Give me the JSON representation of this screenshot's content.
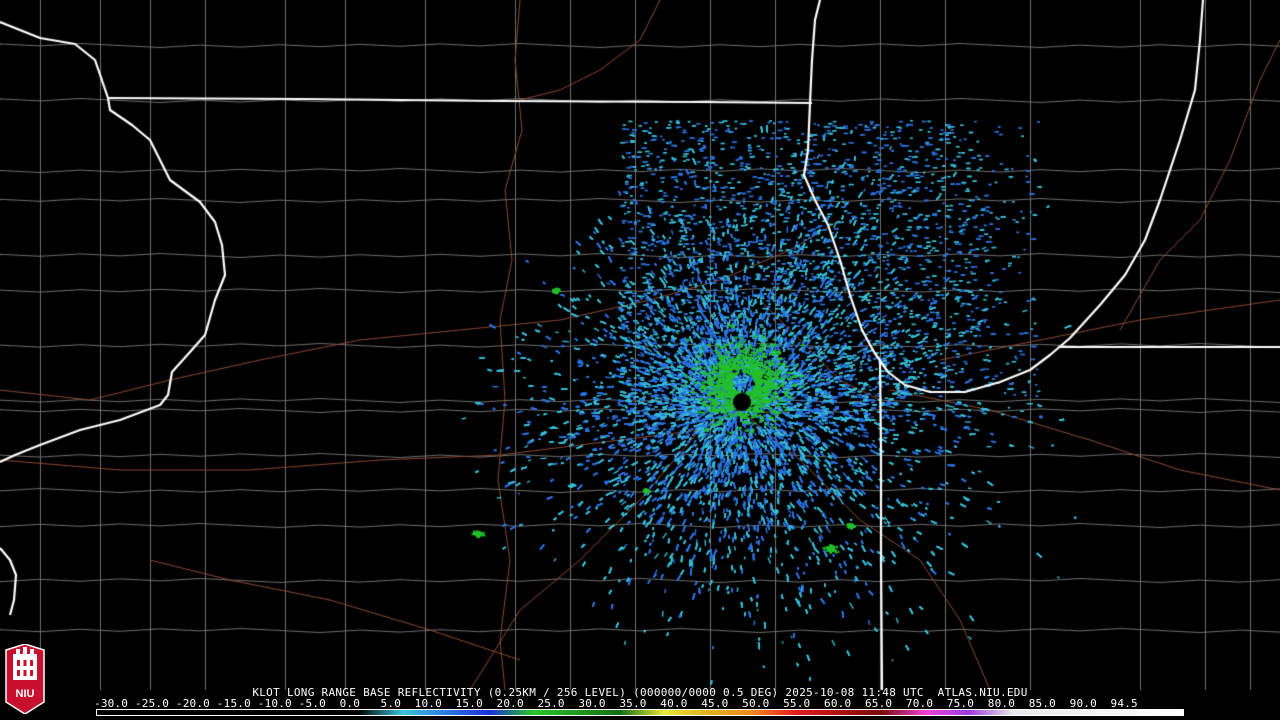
{
  "product": {
    "caption": "KLOT LONG RANGE BASE REFLECTIVITY (0.25KM / 256 LEVEL) (000000/0000 0.5 DEG) 2025-10-08 11:48 UTC  ATLAS.NIU.EDU",
    "radar_site": "KLOT",
    "datetime_utc": "2025-10-08 11:48 UTC",
    "source": "ATLAS.NIU.EDU"
  },
  "colorbar": {
    "ticks_text": "-30.0 -25.0 -20.0 -15.0 -10.0 -5.0  0.0   5.0  10.0  15.0  20.0  25.0  30.0  35.0  40.0  45.0  50.0  55.0  60.0  65.0  70.0  75.0  80.0  85.0  90.0  94.5",
    "stops": [
      {
        "value": -30,
        "color": "#000000"
      },
      {
        "value": 0,
        "color": "#000000"
      },
      {
        "value": 5,
        "color": "#39c3d8"
      },
      {
        "value": 10,
        "color": "#2b7ce0"
      },
      {
        "value": 15,
        "color": "#1a2fd8"
      },
      {
        "value": 20,
        "color": "#27c52a"
      },
      {
        "value": 25,
        "color": "#1f9a1f"
      },
      {
        "value": 30,
        "color": "#137013"
      },
      {
        "value": 35,
        "color": "#e8e83a"
      },
      {
        "value": 40,
        "color": "#e0b020"
      },
      {
        "value": 45,
        "color": "#f08a1a"
      },
      {
        "value": 50,
        "color": "#e41c1c"
      },
      {
        "value": 55,
        "color": "#b01010"
      },
      {
        "value": 60,
        "color": "#7a0a0a"
      },
      {
        "value": 65,
        "color": "#f040d8"
      },
      {
        "value": 70,
        "color": "#9c3ce0"
      },
      {
        "value": 75,
        "color": "#e8e8e8"
      },
      {
        "value": 94.5,
        "color": "#ffffff"
      }
    ]
  },
  "colors": {
    "state_border": "#ffffff",
    "county_border": "#6f6f6f",
    "highway": "#8a4a32",
    "echo_light": "#35bdd8",
    "echo_medium": "#2a72e0",
    "echo_strong": "#23c02a"
  },
  "logo": {
    "text": "NIU",
    "color": "#c8102e"
  }
}
